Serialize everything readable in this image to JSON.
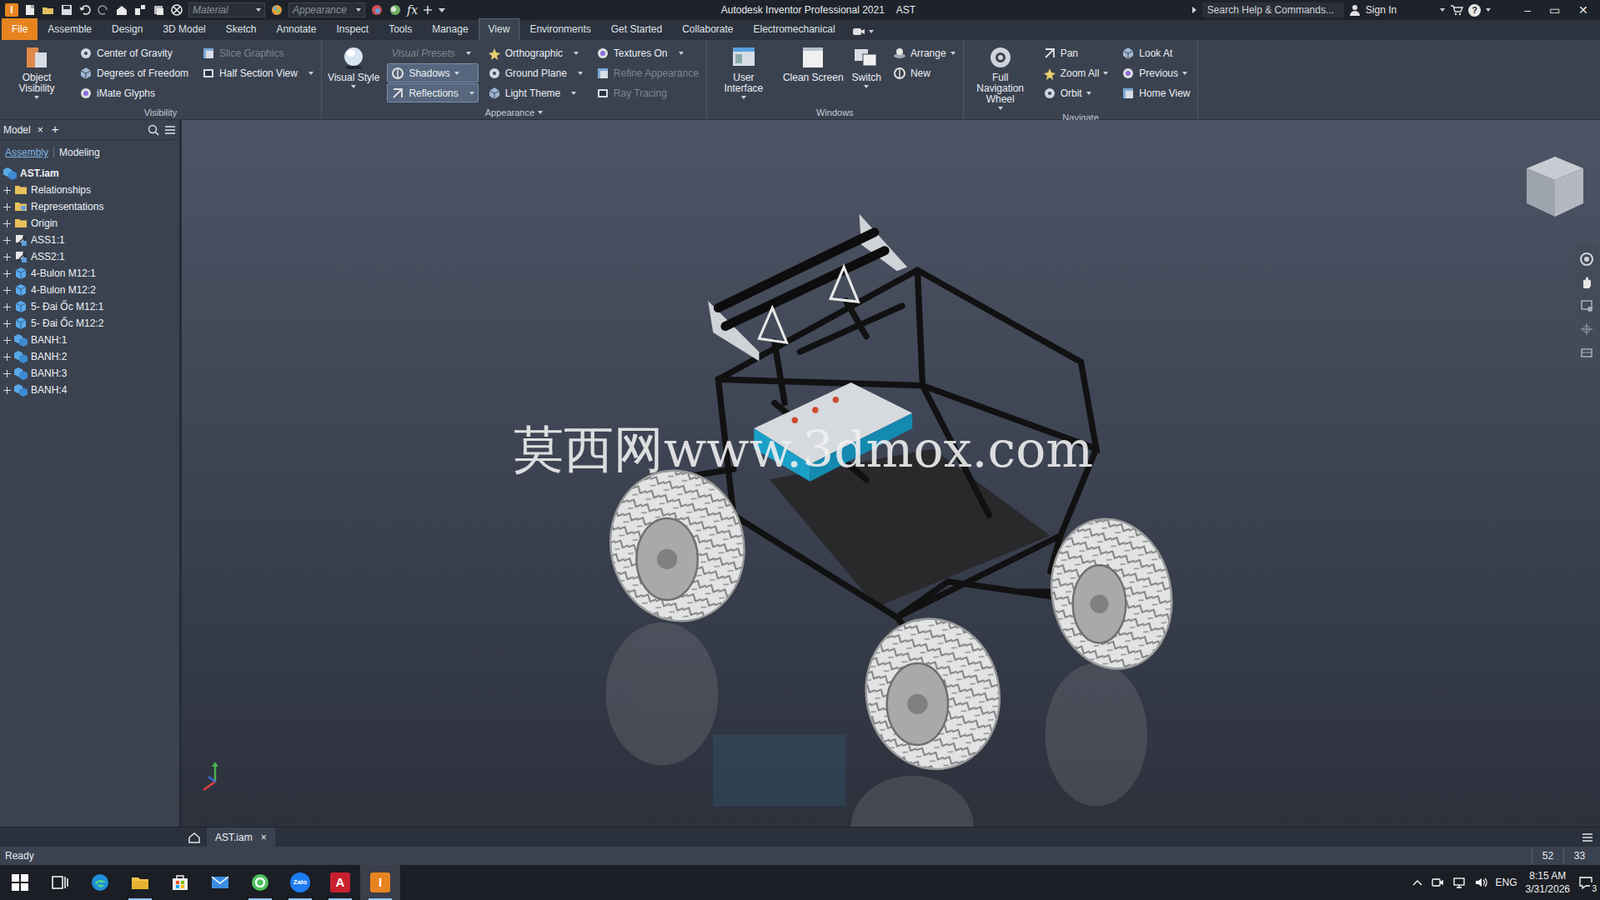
{
  "window": {
    "logo": "I",
    "title": "Autodesk Inventor Professional 2021",
    "document": "AST",
    "controls": [
      "–",
      "▭",
      "✕"
    ]
  },
  "quick_access": {
    "material": "Material",
    "appearance": "Appearance",
    "formula": "fx"
  },
  "search": {
    "placeholder": "Search Help & Commands..."
  },
  "account": {
    "sign_in": "Sign In",
    "help": "?"
  },
  "ribbon_tabs": [
    {
      "label": "File",
      "kind": "menu",
      "selected": false
    },
    {
      "label": "Assemble",
      "kind": "tab",
      "selected": false
    },
    {
      "label": "Design",
      "kind": "tab",
      "selected": false
    },
    {
      "label": "3D Model",
      "kind": "tab",
      "selected": false
    },
    {
      "label": "Sketch",
      "kind": "tab",
      "selected": false
    },
    {
      "label": "Annotate",
      "kind": "tab",
      "selected": false
    },
    {
      "label": "Inspect",
      "kind": "tab",
      "selected": false
    },
    {
      "label": "Tools",
      "kind": "tab",
      "selected": false
    },
    {
      "label": "Manage",
      "kind": "tab",
      "selected": false
    },
    {
      "label": "View",
      "kind": "tab",
      "selected": true
    },
    {
      "label": "Environments",
      "kind": "tab",
      "selected": false
    },
    {
      "label": "Get Started",
      "kind": "tab",
      "selected": false
    },
    {
      "label": "Collaborate",
      "kind": "tab",
      "selected": false
    },
    {
      "label": "Electromechanical",
      "kind": "tab",
      "selected": false
    }
  ],
  "ribbon_panels": [
    {
      "title": "Visibility",
      "dropdown": false,
      "columns": [
        {
          "kind": "large",
          "items": [
            {
              "label": "Object Visibility",
              "kind": "button",
              "dropdown": true,
              "disabled": false,
              "active": false
            }
          ]
        },
        {
          "kind": "small",
          "items": [
            {
              "label": "Center of Gravity",
              "kind": "button",
              "dropdown": false,
              "disabled": false,
              "active": false
            },
            {
              "label": "Degrees of Freedom",
              "kind": "button",
              "dropdown": false,
              "disabled": false,
              "active": false
            },
            {
              "label": "iMate Glyphs",
              "kind": "button",
              "dropdown": false,
              "disabled": false,
              "active": false
            }
          ]
        },
        {
          "kind": "small",
          "items": [
            {
              "label": "Slice Graphics",
              "kind": "button",
              "dropdown": false,
              "disabled": true,
              "active": false
            },
            {
              "label": "Half Section View",
              "kind": "button",
              "dropdown": true,
              "disabled": false,
              "active": false
            }
          ]
        }
      ]
    },
    {
      "title": "Appearance",
      "dropdown": true,
      "columns": [
        {
          "kind": "large",
          "items": [
            {
              "label": "Visual Style",
              "kind": "button",
              "dropdown": true,
              "disabled": false,
              "active": false
            }
          ]
        },
        {
          "kind": "small",
          "items": [
            {
              "label": "Visual Presets",
              "kind": "combo",
              "dropdown": true,
              "disabled": true,
              "active": false
            },
            {
              "label": "Shadows",
              "kind": "button",
              "dropdown": true,
              "disabled": false,
              "active": true
            },
            {
              "label": "Reflections",
              "kind": "button",
              "dropdown": true,
              "disabled": false,
              "active": true
            }
          ]
        },
        {
          "kind": "small",
          "items": [
            {
              "label": "Orthographic",
              "kind": "button",
              "dropdown": true,
              "disabled": false,
              "active": false
            },
            {
              "label": "Ground Plane",
              "kind": "button",
              "dropdown": true,
              "disabled": false,
              "active": false
            },
            {
              "label": "Light Theme",
              "kind": "button",
              "dropdown": true,
              "disabled": false,
              "active": false
            }
          ]
        },
        {
          "kind": "small",
          "items": [
            {
              "label": "Textures On",
              "kind": "button",
              "dropdown": true,
              "disabled": false,
              "active": false
            },
            {
              "label": "Refine Appearance",
              "kind": "button",
              "dropdown": false,
              "disabled": true,
              "active": false
            },
            {
              "label": "Ray Tracing",
              "kind": "button",
              "dropdown": false,
              "disabled": true,
              "active": false
            }
          ]
        }
      ]
    },
    {
      "title": "Windows",
      "dropdown": false,
      "columns": [
        {
          "kind": "large",
          "items": [
            {
              "label": "User Interface",
              "kind": "button",
              "dropdown": true,
              "disabled": false,
              "active": false
            },
            {
              "label": "Clean Screen",
              "kind": "button",
              "dropdown": false,
              "disabled": false,
              "active": false
            },
            {
              "label": "Switch",
              "kind": "button",
              "dropdown": true,
              "disabled": false,
              "active": false
            }
          ]
        },
        {
          "kind": "small",
          "items": [
            {
              "label": "Arrange",
              "kind": "button",
              "dropdown": true,
              "disabled": false,
              "active": false
            },
            {
              "label": "New",
              "kind": "button",
              "dropdown": false,
              "disabled": false,
              "active": false
            }
          ]
        }
      ]
    },
    {
      "title": "Navigate",
      "dropdown": false,
      "columns": [
        {
          "kind": "large",
          "items": [
            {
              "label": "Full Navigation Wheel",
              "kind": "button",
              "dropdown": true,
              "disabled": false,
              "active": false
            }
          ]
        },
        {
          "kind": "small",
          "items": [
            {
              "label": "Pan",
              "kind": "button",
              "dropdown": false,
              "disabled": false,
              "active": false
            },
            {
              "label": "Zoom All",
              "kind": "button",
              "dropdown": true,
              "disabled": false,
              "active": false
            },
            {
              "label": "Orbit",
              "kind": "button",
              "dropdown": true,
              "disabled": false,
              "active": false
            }
          ]
        },
        {
          "kind": "small",
          "items": [
            {
              "label": "Look At",
              "kind": "button",
              "dropdown": false,
              "disabled": false,
              "active": false
            },
            {
              "label": "Previous",
              "kind": "button",
              "dropdown": true,
              "disabled": false,
              "active": false
            },
            {
              "label": "Home View",
              "kind": "button",
              "dropdown": false,
              "disabled": false,
              "active": false
            }
          ]
        }
      ]
    }
  ],
  "browser": {
    "tabs": [
      {
        "label": "Model",
        "close": "×",
        "selected": true
      }
    ],
    "add": "+",
    "subtabs": [
      {
        "label": "Assembly",
        "selected": true
      },
      {
        "label": "Modeling",
        "selected": false
      }
    ],
    "root": "AST.iam",
    "items": [
      {
        "label": "Relationships",
        "kind": "folder",
        "expanded": false
      },
      {
        "label": "Representations",
        "kind": "representations",
        "expanded": false
      },
      {
        "label": "Origin",
        "kind": "folder",
        "expanded": false
      },
      {
        "label": "ASS1:1",
        "kind": "subassembly",
        "expanded": false
      },
      {
        "label": "ASS2:1",
        "kind": "subassembly",
        "expanded": false
      },
      {
        "label": "4-Bulon M12:1",
        "kind": "part",
        "expanded": false
      },
      {
        "label": "4-Bulon M12:2",
        "kind": "part",
        "expanded": false
      },
      {
        "label": "5- Đai Ốc M12:1",
        "kind": "part",
        "expanded": false
      },
      {
        "label": "5- Đai Ốc M12:2",
        "kind": "part",
        "expanded": false
      },
      {
        "label": "BANH:1",
        "kind": "assembly",
        "expanded": false
      },
      {
        "label": "BANH:2",
        "kind": "assembly",
        "expanded": false
      },
      {
        "label": "BANH:3",
        "kind": "assembly",
        "expanded": false
      },
      {
        "label": "BANH:4",
        "kind": "assembly",
        "expanded": false
      }
    ]
  },
  "viewport": {
    "watermark": "莫西网www.3dmox.com"
  },
  "document_tabs": [
    {
      "label": "AST.iam",
      "close": "×",
      "selected": true
    }
  ],
  "status_bar": {
    "text": "Ready",
    "counts": [
      "52",
      "33"
    ]
  },
  "taskbar": {
    "apps": [
      {
        "kind": "start",
        "running": false,
        "selected": false
      },
      {
        "kind": "task-view",
        "running": false,
        "selected": false
      },
      {
        "kind": "edge",
        "running": false,
        "selected": false
      },
      {
        "kind": "explorer",
        "running": true,
        "selected": false
      },
      {
        "kind": "store",
        "running": false,
        "selected": false
      },
      {
        "kind": "mail",
        "running": false,
        "selected": false
      },
      {
        "kind": "green-app",
        "running": true,
        "selected": false
      },
      {
        "kind": "zalo",
        "glyph": "Zalo",
        "running": true,
        "selected": false
      },
      {
        "kind": "autocad",
        "glyph": "A",
        "running": true,
        "selected": false
      },
      {
        "kind": "inventor",
        "glyph": "I",
        "running": true,
        "selected": true
      }
    ],
    "language": "ENG",
    "time": "8:15 AM",
    "date": "3/31/2026",
    "notifications": "3"
  }
}
